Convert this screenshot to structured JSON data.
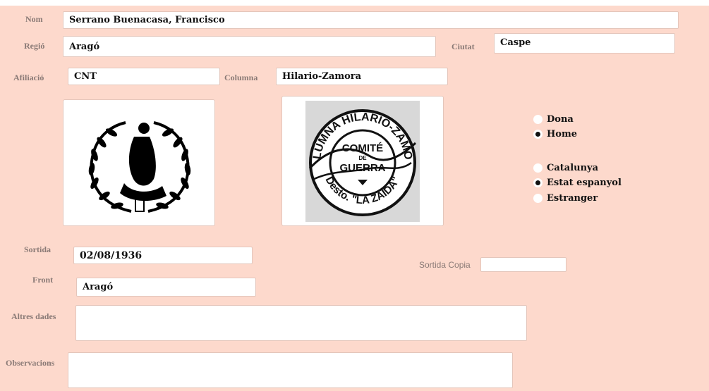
{
  "fields": {
    "nom": {
      "label": "Nom",
      "value": "Serrano Buenacasa, Francisco"
    },
    "regio": {
      "label": "Regió",
      "value": "Aragó"
    },
    "ciutat": {
      "label": "Ciutat",
      "value": "Caspe"
    },
    "afiliacio": {
      "label": "Afiliació",
      "value": "CNT"
    },
    "columna": {
      "label": "Columna",
      "value": "Hilario-Zamora"
    },
    "sortida": {
      "label": "Sortida",
      "value": "02/08/1936"
    },
    "sortida_copia": {
      "label": "Sortida Copia",
      "value": ""
    },
    "front": {
      "label": "Front",
      "value": "Aragó"
    },
    "altres_dades": {
      "label": "Altres dades",
      "value": ""
    },
    "observacions": {
      "label": "Observacions",
      "value": ""
    }
  },
  "gender": {
    "options": [
      {
        "label": "Dona",
        "selected": false
      },
      {
        "label": "Home",
        "selected": true
      }
    ]
  },
  "origin": {
    "options": [
      {
        "label": "Catalunya",
        "selected": false
      },
      {
        "label": "Estat espanyol",
        "selected": true
      },
      {
        "label": "Estranger",
        "selected": false
      }
    ]
  },
  "images": {
    "emblem": {
      "icon": "laurel-wreath-emblem-icon"
    },
    "stamp": {
      "icon": "committee-stamp-icon",
      "text_top": "COLUMNA HILARIO-ZAMORA",
      "text_center_1": "COMITÉ",
      "text_center_2": "DE",
      "text_center_3": "GUERRA",
      "text_bottom": "Desto. \"LA ZAIDA\""
    }
  },
  "colors": {
    "form_background": "#fdd9cc",
    "label": "#8a7a76",
    "field_border": "#e4c6bb"
  }
}
